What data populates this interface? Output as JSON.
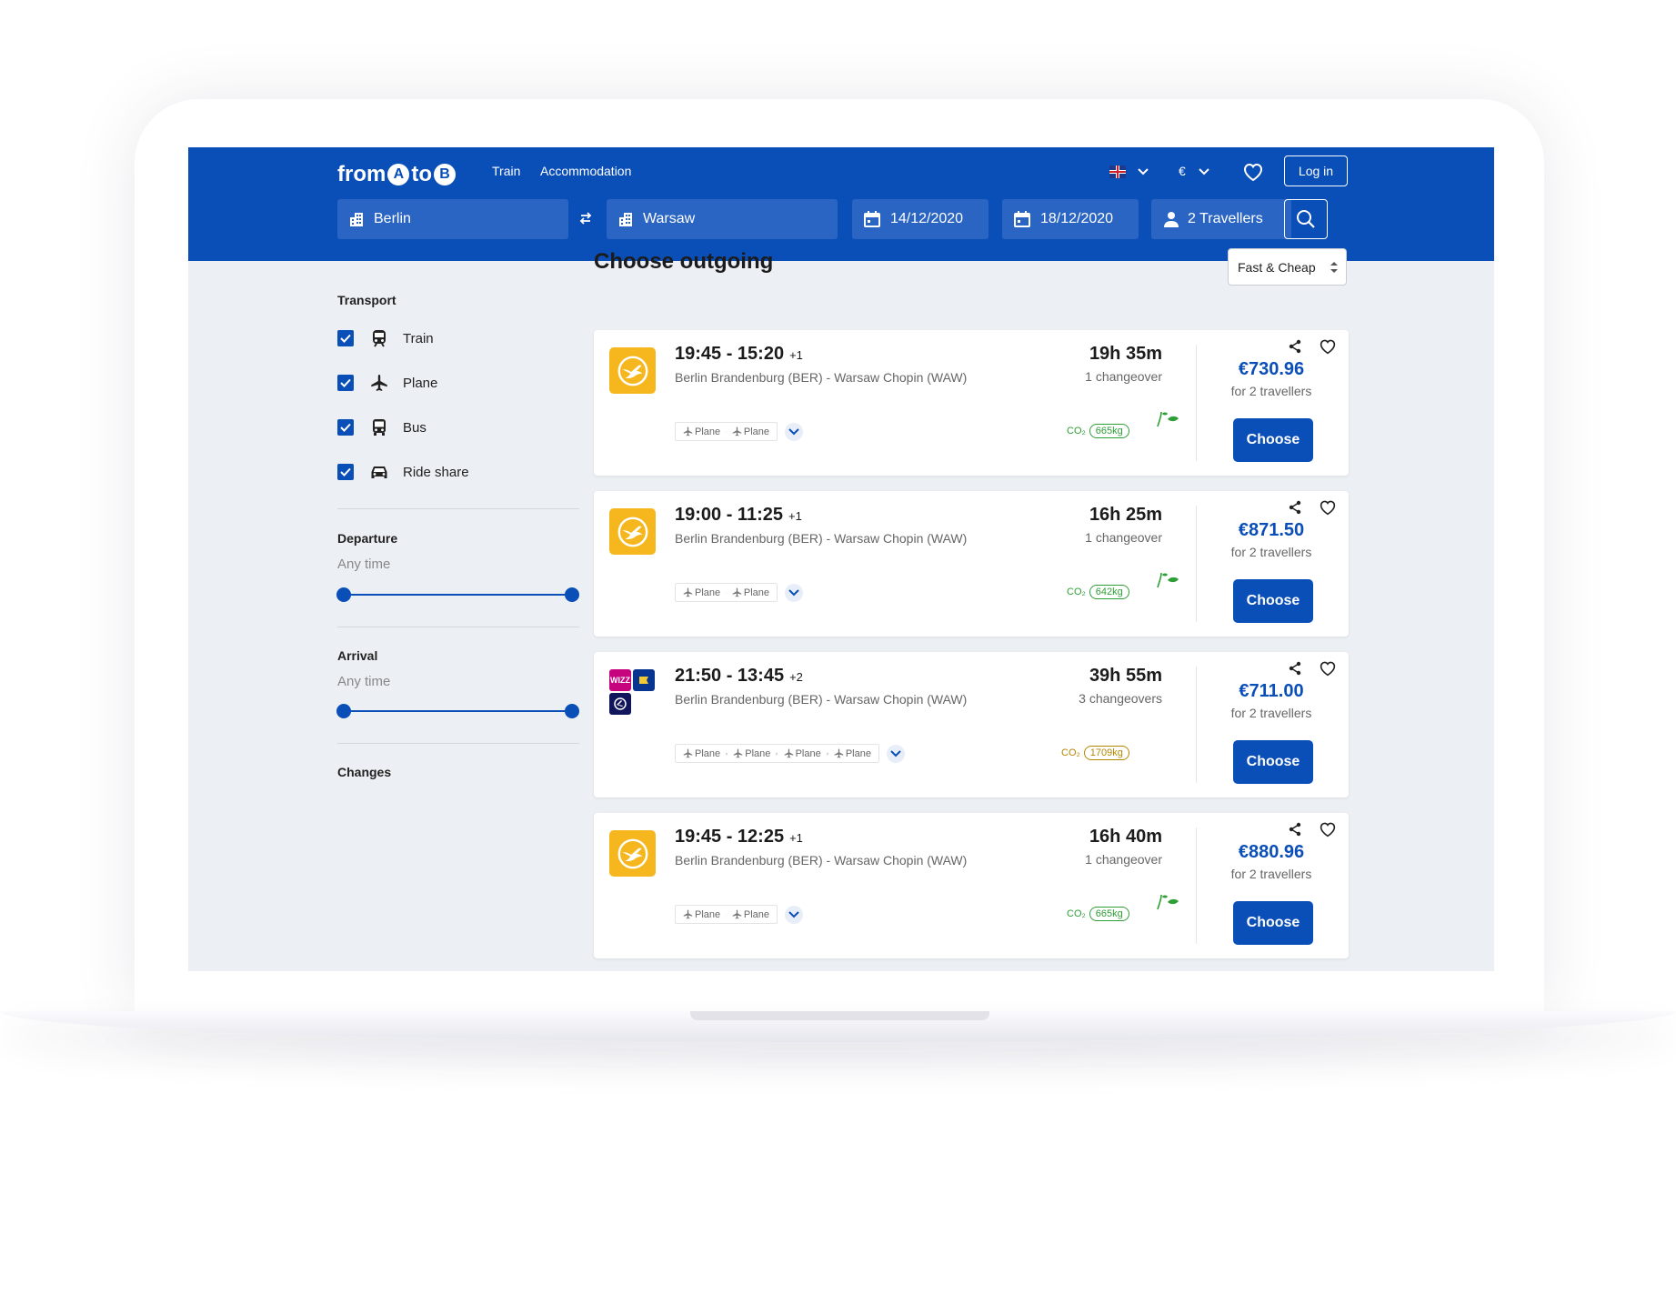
{
  "header": {
    "logo": {
      "part1": "from",
      "a": "A",
      "to": "to",
      "b": "B"
    },
    "nav": [
      "Train",
      "Accommodation"
    ],
    "currency": "€",
    "login": "Log in"
  },
  "search": {
    "from": "Berlin",
    "to": "Warsaw",
    "depart_date": "14/12/2020",
    "return_date": "18/12/2020",
    "travellers": "2 Travellers"
  },
  "sidebar": {
    "transport_title": "Transport",
    "transport": [
      {
        "label": "Train",
        "icon": "train-icon",
        "checked": true
      },
      {
        "label": "Plane",
        "icon": "plane-icon",
        "checked": true
      },
      {
        "label": "Bus",
        "icon": "bus-icon",
        "checked": true
      },
      {
        "label": "Ride share",
        "icon": "car-icon",
        "checked": true
      }
    ],
    "departure_title": "Departure",
    "departure_value": "Any time",
    "departure_range": [
      0,
      1
    ],
    "arrival_title": "Arrival",
    "arrival_value": "Any time",
    "arrival_range": [
      0,
      1
    ],
    "changes_title": "Changes"
  },
  "main": {
    "title": "Choose outgoing",
    "sort": "Fast & Cheap"
  },
  "results": [
    {
      "times": "19:45 - 15:20",
      "plus": "+1",
      "route": "Berlin Brandenburg (BER) - Warsaw Chopin (WAW)",
      "duration": "19h 35m",
      "changes": "1 changeover",
      "segments": [
        "Plane",
        "Plane"
      ],
      "co2_label": "CO₂",
      "co2": "665kg",
      "co2_color": "#2e9e36",
      "price": "€730.96",
      "price_note": "for 2 travellers",
      "choose": "Choose",
      "airline": "lufthansa"
    },
    {
      "times": "19:00 - 11:25",
      "plus": "+1",
      "route": "Berlin Brandenburg (BER) - Warsaw Chopin (WAW)",
      "duration": "16h 25m",
      "changes": "1 changeover",
      "segments": [
        "Plane",
        "Plane"
      ],
      "co2_label": "CO₂",
      "co2": "642kg",
      "co2_color": "#2e9e36",
      "price": "€871.50",
      "price_note": "for 2 travellers",
      "choose": "Choose",
      "airline": "lufthansa"
    },
    {
      "times": "21:50 - 13:45",
      "plus": "+2",
      "route": "Berlin Brandenburg (BER) - Warsaw Chopin (WAW)",
      "duration": "39h 55m",
      "changes": "3 changeovers",
      "segments": [
        "Plane",
        "Plane",
        "Plane",
        "Plane"
      ],
      "co2_label": "CO₂",
      "co2": "1709kg",
      "co2_color": "#b38600",
      "price": "€711.00",
      "price_note": "for 2 travellers",
      "choose": "Choose",
      "airline": "multi",
      "multi_logo_text": "WIZZ"
    },
    {
      "times": "19:45 - 12:25",
      "plus": "+1",
      "route": "Berlin Brandenburg (BER) - Warsaw Chopin (WAW)",
      "duration": "16h 40m",
      "changes": "1 changeover",
      "segments": [
        "Plane",
        "Plane"
      ],
      "co2_label": "CO₂",
      "co2": "665kg",
      "co2_color": "#2e9e36",
      "price": "€880.96",
      "price_note": "for 2 travellers",
      "choose": "Choose",
      "airline": "lufthansa"
    }
  ],
  "colors": {
    "brand": "#0a4eb8",
    "lufthansa": "#f5b71d",
    "eco_green": "#2e9e36",
    "eco_amber": "#b38600"
  }
}
